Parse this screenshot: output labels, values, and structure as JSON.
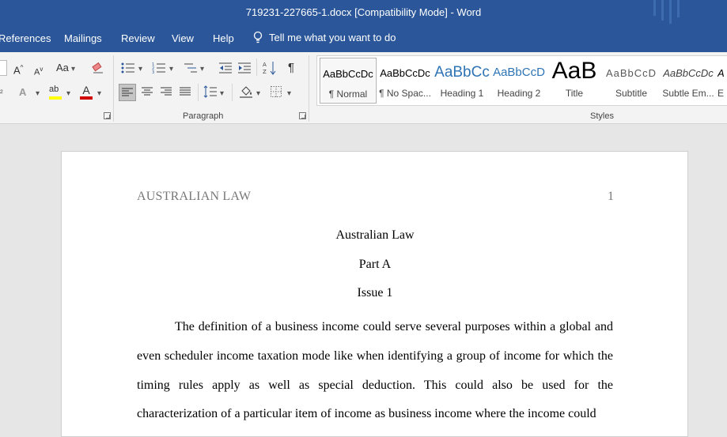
{
  "window": {
    "title": "719231-227665-1.docx [Compatibility Mode]  -  Word"
  },
  "tabs": [
    {
      "label": "References"
    },
    {
      "label": "Mailings"
    },
    {
      "label": "Review"
    },
    {
      "label": "View"
    },
    {
      "label": "Help"
    }
  ],
  "tell_me": "Tell me what you want to do",
  "ribbon": {
    "font_group": {
      "change_case": "Aa"
    },
    "paragraph_label": "Paragraph",
    "styles_label": "Styles",
    "styles": [
      {
        "sample": "AaBbCcDc",
        "label": "¶ Normal"
      },
      {
        "sample": "AaBbCcDc",
        "label": "¶ No Spac..."
      },
      {
        "sample": "AaBbCc",
        "label": "Heading 1"
      },
      {
        "sample": "AaBbCcD",
        "label": "Heading 2"
      },
      {
        "sample": "AaB",
        "label": "Title"
      },
      {
        "sample": "AaBbCcD",
        "label": "Subtitle"
      },
      {
        "sample": "AaBbCcDc",
        "label": "Subtle Em..."
      },
      {
        "sample": "A",
        "label": "E"
      }
    ]
  },
  "document": {
    "header_left": "AUSTRALIAN LAW",
    "page_number": "1",
    "title": "Australian Law",
    "part": "Part A",
    "issue": "Issue 1",
    "paragraph": "The definition of a business income could serve several purposes within a global and even scheduler income taxation mode like when identifying a group of income for which the timing rules apply as well as special deduction. This could also be used for the characterization of a particular item of income as business income where the income could"
  },
  "colors": {
    "accent": "#2b579a",
    "highlight": "#ffff00",
    "font_color": "#d00000"
  }
}
